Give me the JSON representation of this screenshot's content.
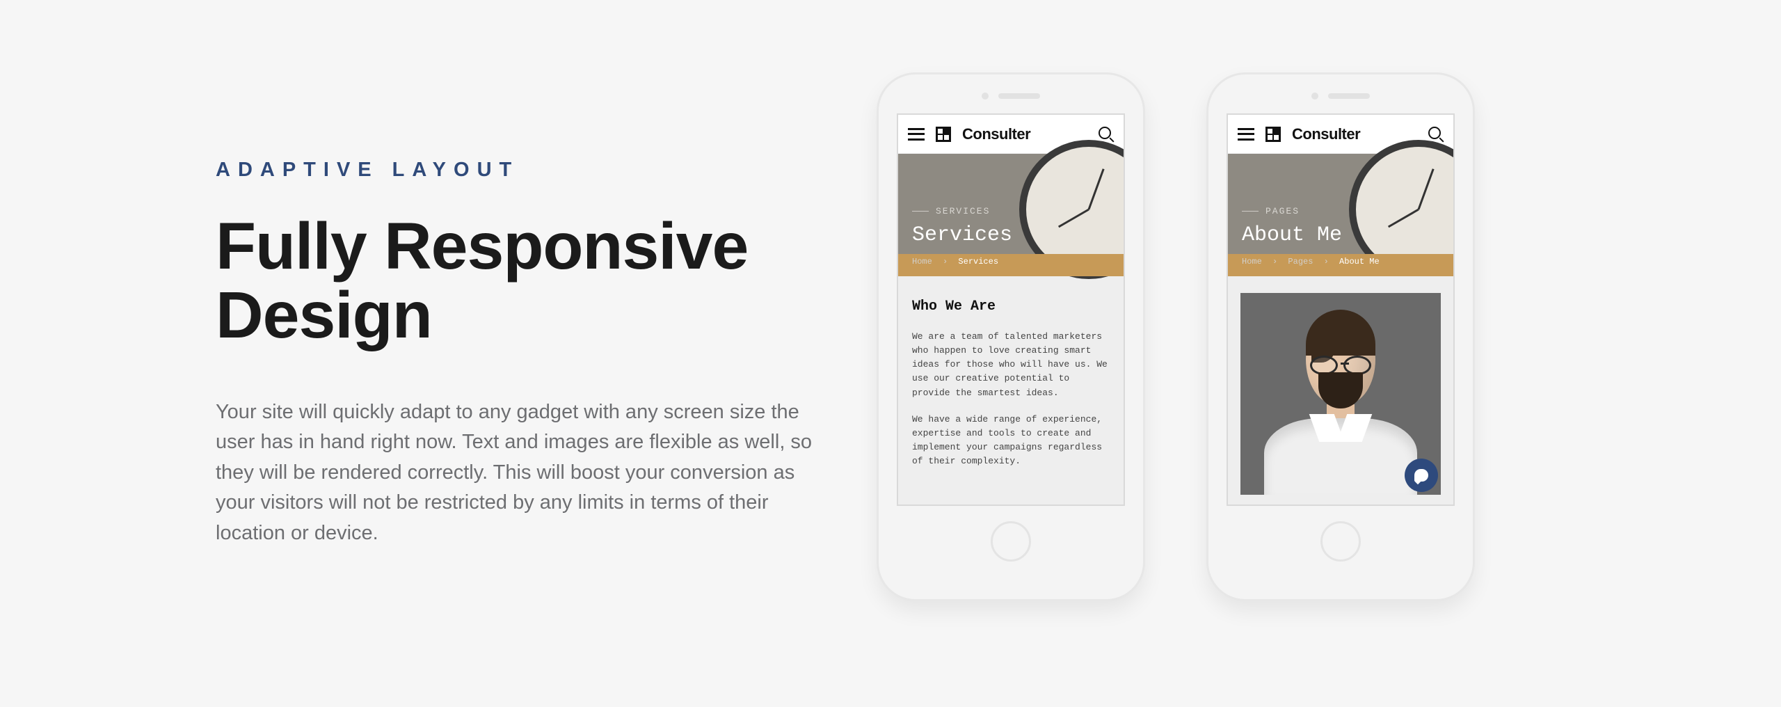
{
  "eyebrow": "ADAPTIVE LAYOUT",
  "heading": "Fully Responsive Design",
  "body": "Your site will quickly adapt to any gadget with any screen size the user has in hand right now. Text and images are flexible as well, so they will be rendered correctly. This will boost your conversion as your visitors will not be restricted by any limits in terms of their location or device.",
  "mockup1": {
    "brand": "Consulter",
    "hero_category": "SERVICES",
    "hero_title": "Services",
    "crumb_home": "Home",
    "crumb_current": "Services",
    "section_title": "Who We Are",
    "para1": "We are a team of talented marketers who happen to love creating smart ideas for those who will have us. We use our creative potential to provide the smartest ideas.",
    "para2": "We have a wide range of experience, expertise and tools to create and implement your campaigns regardless of their complexity."
  },
  "mockup2": {
    "brand": "Consulter",
    "hero_category": "PAGES",
    "hero_title": "About Me",
    "crumb_home": "Home",
    "crumb_mid": "Pages",
    "crumb_current": "About Me"
  },
  "colors": {
    "accent": "#2e4a7d"
  }
}
